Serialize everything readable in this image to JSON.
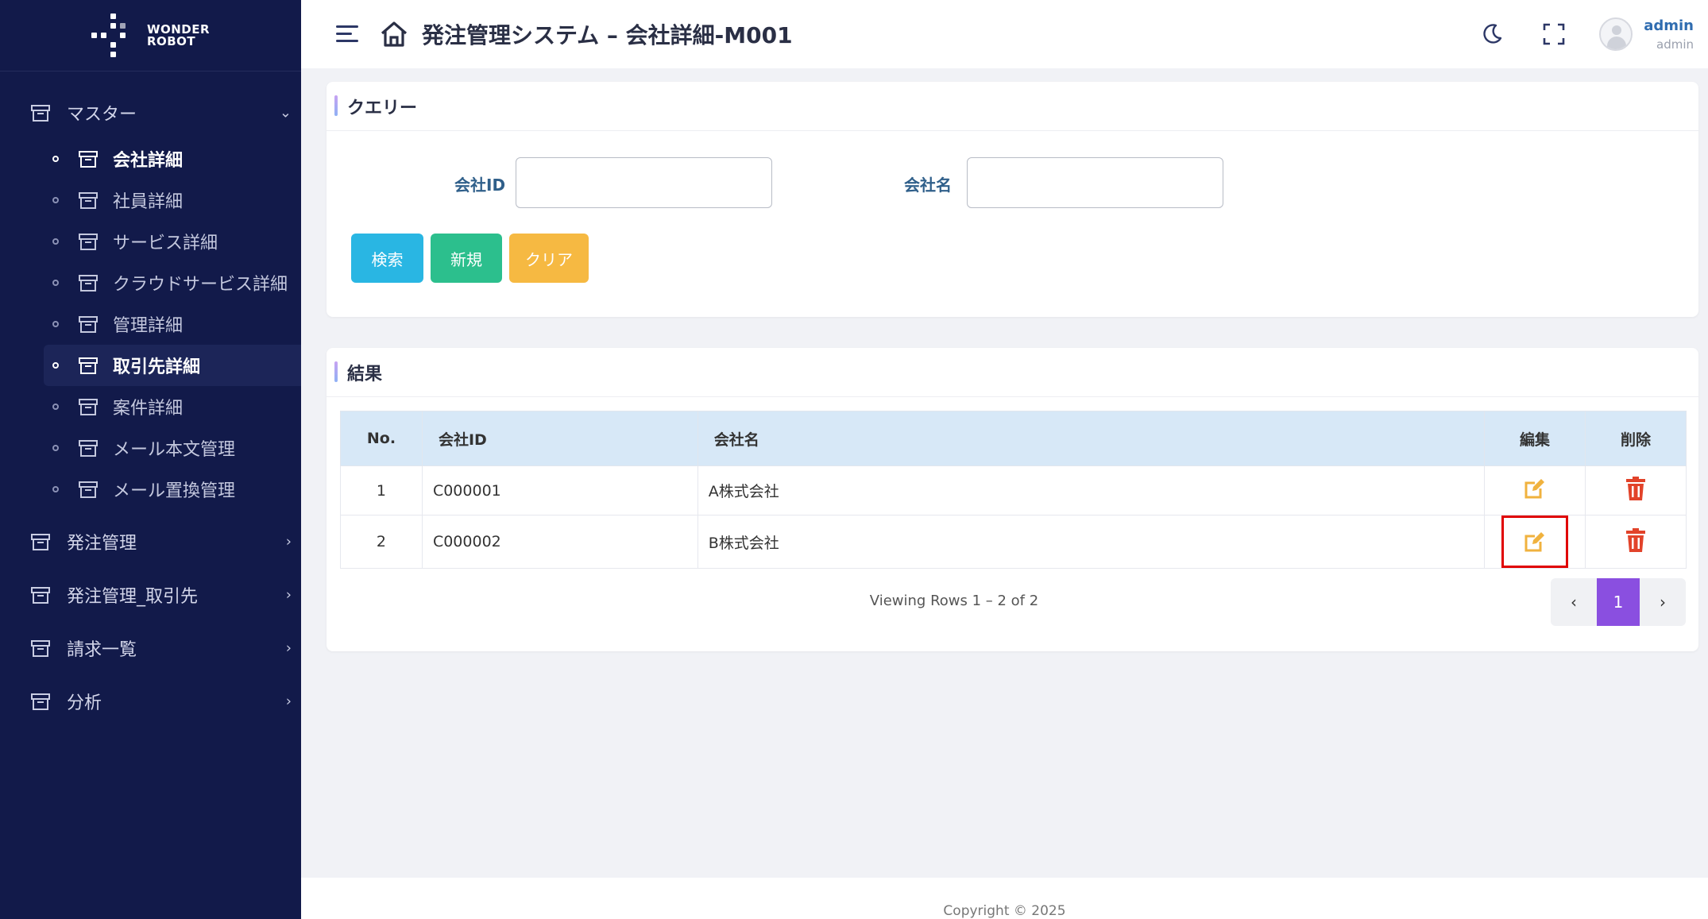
{
  "brand": {
    "line1": "WONDER",
    "line2": "ROBOT"
  },
  "header": {
    "title": "発注管理システム – 会社詳細-M001"
  },
  "user": {
    "name": "admin",
    "role": "admin"
  },
  "sidebar": {
    "master_label": "マスター",
    "master_items": [
      {
        "label": "会社詳細"
      },
      {
        "label": "社員詳細"
      },
      {
        "label": "サービス詳細"
      },
      {
        "label": "クラウドサービス詳細"
      },
      {
        "label": "管理詳細"
      },
      {
        "label": "取引先詳細"
      },
      {
        "label": "案件詳細"
      },
      {
        "label": "メール本文管理"
      },
      {
        "label": "メール置換管理"
      }
    ],
    "groups": [
      {
        "label": "発注管理"
      },
      {
        "label": "発注管理_取引先"
      },
      {
        "label": "請求一覧"
      },
      {
        "label": "分析"
      }
    ]
  },
  "query": {
    "title": "クエリー",
    "company_id_label": "会社ID",
    "company_id_value": "",
    "company_name_label": "会社名",
    "company_name_value": "",
    "search_label": "検索",
    "new_label": "新規",
    "clear_label": "クリア"
  },
  "results": {
    "title": "結果",
    "columns": {
      "no": "No.",
      "id": "会社ID",
      "name": "会社名",
      "edit": "編集",
      "delete": "削除"
    },
    "rows": [
      {
        "no": "1",
        "id": "C000001",
        "name": "A株式会社"
      },
      {
        "no": "2",
        "id": "C000002",
        "name": "B株式会社"
      }
    ],
    "viewing": "Viewing Rows 1 – 2 of 2",
    "page": "1",
    "prev": "‹",
    "next": "›"
  },
  "footer": {
    "copyright": "Copyright © 2025"
  },
  "colors": {
    "sidebar_bg": "#121a4a",
    "search_btn": "#29b6e3",
    "new_btn": "#2cbf8d",
    "clear_btn": "#f6b942",
    "edit_icon": "#f0b23e",
    "delete_icon": "#e2432a",
    "pager_active": "#8a4fe0",
    "highlight_box": "#e00000"
  },
  "icons": [
    "menu-icon",
    "home-icon",
    "moon-icon",
    "fullscreen-icon",
    "archive-icon",
    "edit-icon",
    "trash-icon",
    "chevron-down-icon",
    "chevron-right-icon"
  ]
}
